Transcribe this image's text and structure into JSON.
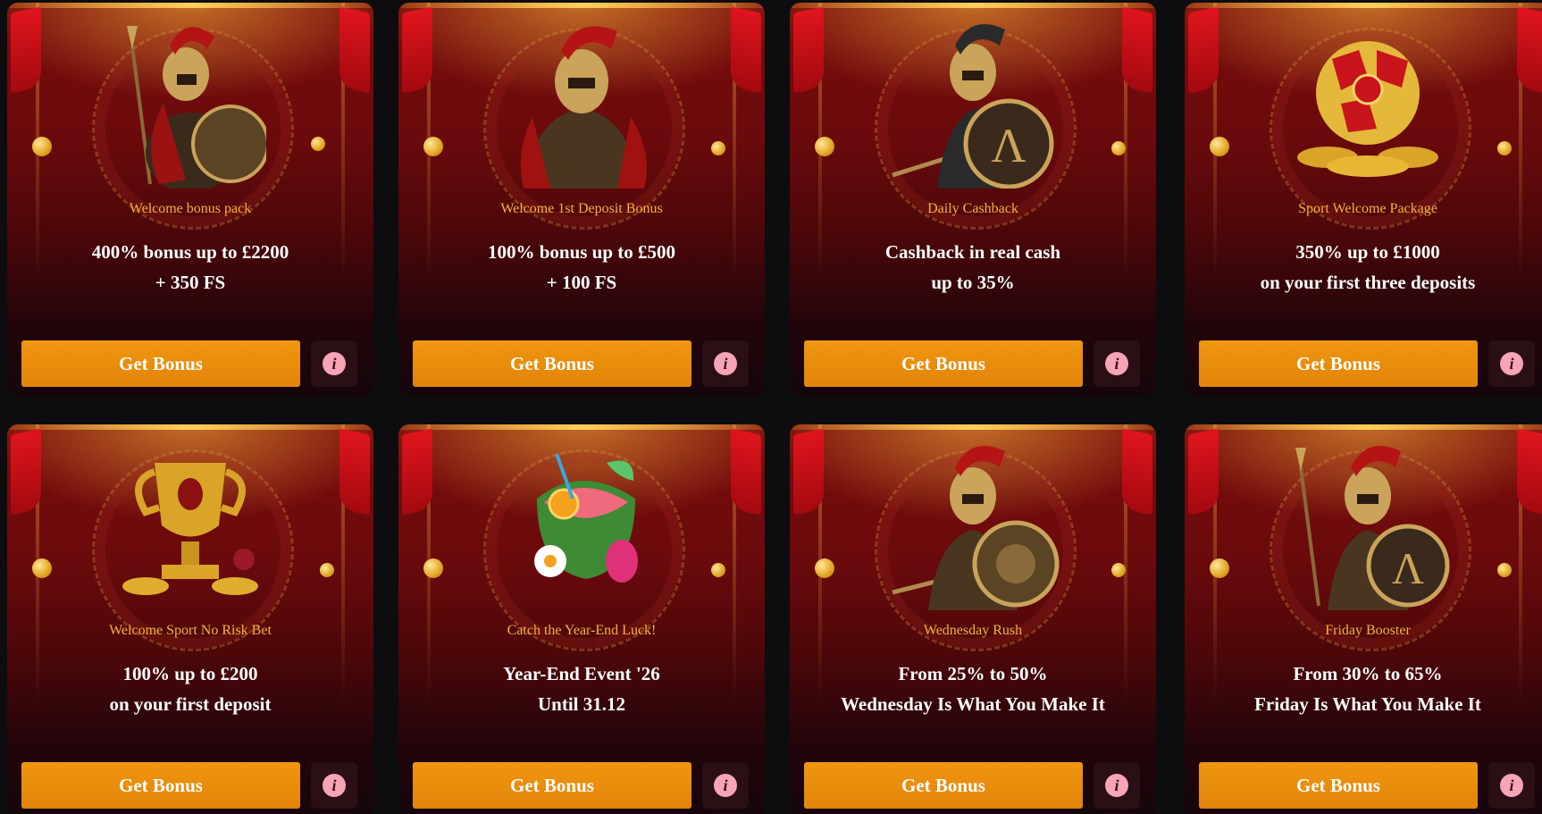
{
  "cards": [
    {
      "category": "Welcome bonus pack",
      "line1": "400% bonus up to £2200",
      "line2": "+ 350 FS",
      "button": "Get Bonus",
      "info_icon": "info-icon",
      "art": "spartan-warrior-spear-shield"
    },
    {
      "category": "Welcome 1st Deposit Bonus",
      "line1": "100% bonus up to £500",
      "line2": "+ 100 FS",
      "button": "Get Bonus",
      "info_icon": "info-icon",
      "art": "spartan-warrior-portrait"
    },
    {
      "category": "Daily Cashback",
      "line1": "Cashback in real cash",
      "line2": "up to 35%",
      "button": "Get Bonus",
      "info_icon": "info-icon",
      "art": "spartan-warrior-lambda-shield"
    },
    {
      "category": "Sport Welcome Package",
      "line1": "350% up to £1000",
      "line2": "on your first three deposits",
      "button": "Get Bonus",
      "info_icon": "info-icon",
      "art": "gold-football-coins"
    },
    {
      "category": "Welcome Sport No Risk Bet",
      "line1": "100% up to £200",
      "line2": "on your first deposit",
      "button": "Get Bonus",
      "info_icon": "info-icon",
      "art": "gold-trophy"
    },
    {
      "category": "Catch the Year-End Luck!",
      "line1": "Year-End Event '26",
      "line2": "Until 31.12",
      "button": "Get Bonus",
      "info_icon": "info-icon",
      "art": "tropical-cocktail"
    },
    {
      "category": "Wednesday Rush",
      "line1": "From 25% to 50%",
      "line2": "Wednesday Is What You Make It",
      "button": "Get Bonus",
      "info_icon": "info-icon",
      "art": "spartan-warrior-lion-shield"
    },
    {
      "category": "Friday Booster",
      "line1": "From 30% to 65%",
      "line2": "Friday Is What You Make It",
      "button": "Get Bonus",
      "info_icon": "info-icon",
      "art": "spartan-warrior-spear-lambda-shield"
    }
  ],
  "colors": {
    "button": "#e88a0c",
    "category_text": "#f3b23a",
    "info_icon": "#f6a4b6",
    "page_background": "#0d0d0f"
  }
}
